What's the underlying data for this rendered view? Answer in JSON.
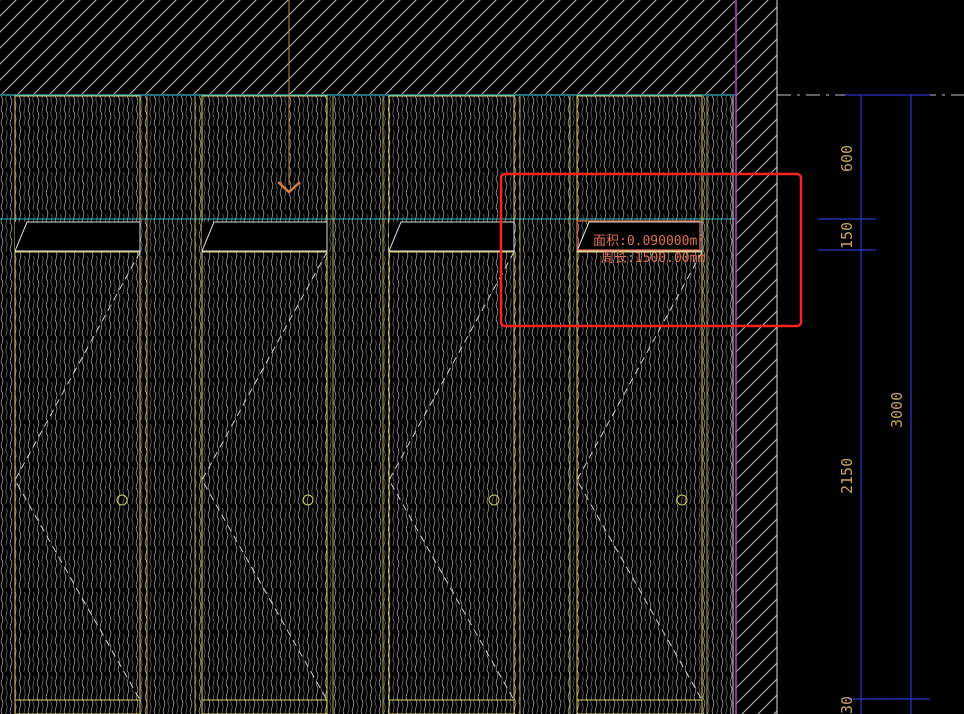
{
  "drawing": {
    "measurement": {
      "area_label": "面积:0.090000m²",
      "perimeter_label": "周长:1500.00mm"
    },
    "dimensions": {
      "d600": "600",
      "d150": "150",
      "d2150": "2150",
      "d3000": "3000",
      "d_bottom": "30"
    },
    "colors": {
      "background": "#000000",
      "panel_edge": "#d8d060",
      "cyan_line": "#30b8c8",
      "magenta_line": "#c040d0",
      "dimension_line": "#3040ff",
      "highlight": "#ff2020",
      "hatch": "#bfbfbf"
    }
  }
}
